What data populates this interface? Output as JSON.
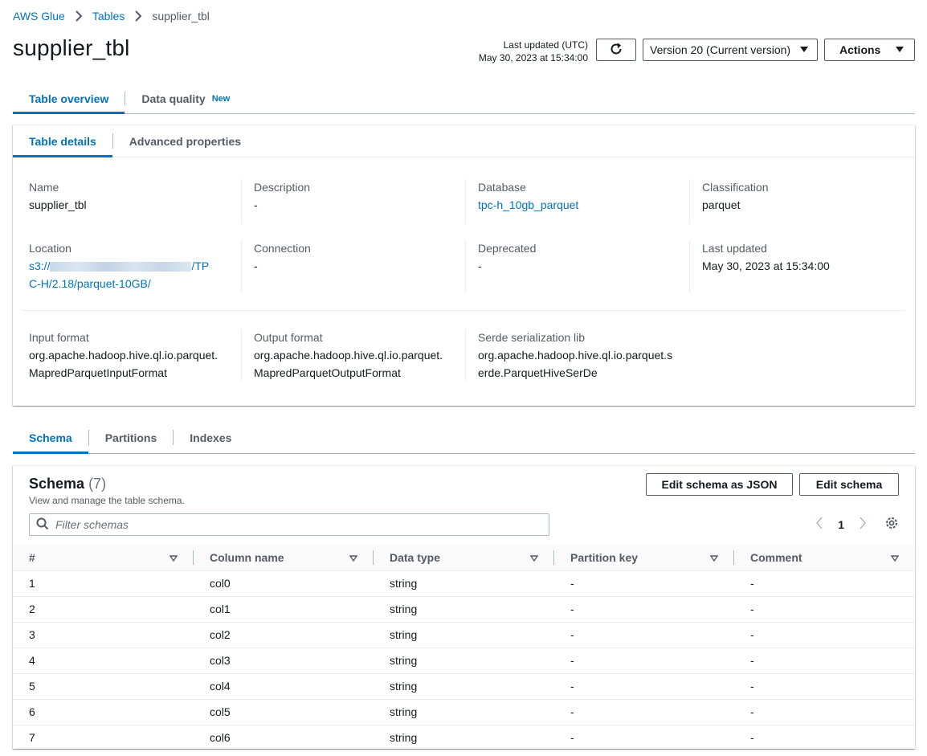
{
  "breadcrumb": {
    "root": "AWS Glue",
    "parent": "Tables",
    "current": "supplier_tbl"
  },
  "page": {
    "title": "supplier_tbl"
  },
  "header": {
    "last_updated_label": "Last updated (UTC)",
    "last_updated_value": "May 30, 2023 at 15:34:00",
    "refresh_icon": "refresh-icon",
    "version_selected": "Version 20 (Current version)",
    "actions_label": "Actions"
  },
  "main_tabs": [
    {
      "label": "Table overview",
      "active": true
    },
    {
      "label": "Data quality",
      "badge": "New",
      "active": false
    }
  ],
  "detail_tabs": [
    {
      "label": "Table details",
      "active": true
    },
    {
      "label": "Advanced properties",
      "active": false
    }
  ],
  "details": {
    "name_label": "Name",
    "name_value": "supplier_tbl",
    "description_label": "Description",
    "description_value": "-",
    "database_label": "Database",
    "database_value": "tpc-h_10gb_parquet",
    "classification_label": "Classification",
    "classification_value": "parquet",
    "location_label": "Location",
    "location_prefix": "s3://",
    "location_suffix": "/TPC-H/2.18/parquet-10GB/",
    "connection_label": "Connection",
    "connection_value": "-",
    "deprecated_label": "Deprecated",
    "deprecated_value": "-",
    "last_updated_label": "Last updated",
    "last_updated_value": "May 30, 2023 at 15:34:00",
    "input_format_label": "Input format",
    "input_format_value": "org.apache.hadoop.hive.ql.io.parquet.MapredParquetInputFormat",
    "output_format_label": "Output format",
    "output_format_value": "org.apache.hadoop.hive.ql.io.parquet.MapredParquetOutputFormat",
    "serde_label": "Serde serialization lib",
    "serde_value": "org.apache.hadoop.hive.ql.io.parquet.serde.ParquetHiveSerDe"
  },
  "sub_tabs": [
    {
      "label": "Schema",
      "active": true
    },
    {
      "label": "Partitions",
      "active": false
    },
    {
      "label": "Indexes",
      "active": false
    }
  ],
  "schema": {
    "title": "Schema",
    "count": "(7)",
    "description": "View and manage the table schema.",
    "edit_json_label": "Edit schema as JSON",
    "edit_label": "Edit schema",
    "filter_placeholder": "Filter schemas",
    "page": "1",
    "columns": [
      "#",
      "Column name",
      "Data type",
      "Partition key",
      "Comment"
    ],
    "rows": [
      [
        "1",
        "col0",
        "string",
        "-",
        "-"
      ],
      [
        "2",
        "col1",
        "string",
        "-",
        "-"
      ],
      [
        "3",
        "col2",
        "string",
        "-",
        "-"
      ],
      [
        "4",
        "col3",
        "string",
        "-",
        "-"
      ],
      [
        "5",
        "col4",
        "string",
        "-",
        "-"
      ],
      [
        "6",
        "col5",
        "string",
        "-",
        "-"
      ],
      [
        "7",
        "col6",
        "string",
        "-",
        "-"
      ]
    ]
  },
  "colors": {
    "link": "#0073bb",
    "text": "#16191f",
    "muted": "#545b64",
    "border": "#aab7b8"
  }
}
